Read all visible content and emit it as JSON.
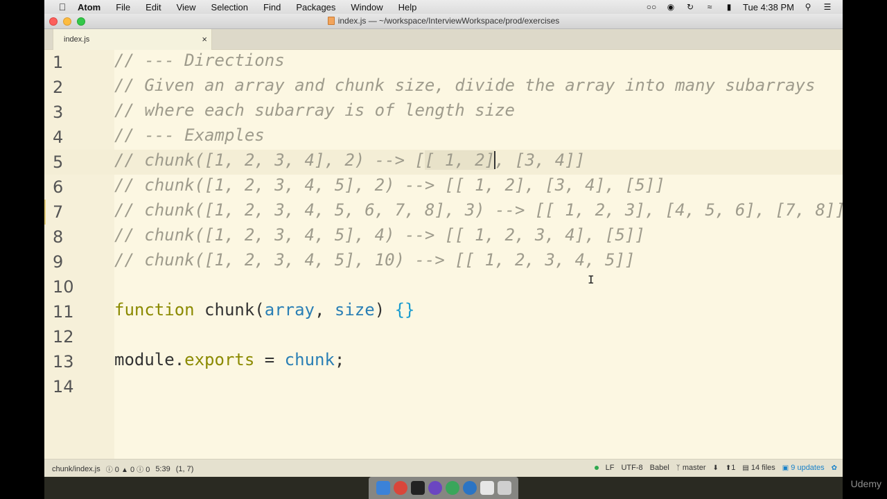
{
  "menubar": {
    "app_name": "Atom",
    "items": [
      "File",
      "Edit",
      "View",
      "Selection",
      "Find",
      "Packages",
      "Window",
      "Help"
    ],
    "clock": "Tue 4:38 PM"
  },
  "window": {
    "title": "index.js — ~/workspace/InterviewWorkspace/prod/exercises"
  },
  "tab": {
    "label": "index.js",
    "close": "×"
  },
  "editor": {
    "line_numbers": [
      "1",
      "2",
      "3",
      "4",
      "5",
      "6",
      "7",
      "8",
      "9",
      "10",
      "11",
      "12",
      "13",
      "14"
    ],
    "lines": {
      "l1": "// --- Directions",
      "l2": "// Given an array and chunk size, divide the array into many subarrays",
      "l3": "// where each subarray is of length size",
      "l4": "// --- Examples",
      "l5a": "// chunk([1, 2, 3, 4], 2) --> [",
      "l5sel": "[ 1, 2]",
      "l5b": ", [3, 4]]",
      "l6": "// chunk([1, 2, 3, 4, 5], 2) --> [[ 1, 2], [3, 4], [5]]",
      "l7": "// chunk([1, 2, 3, 4, 5, 6, 7, 8], 3) --> [[ 1, 2, 3], [4, 5, 6], [7, 8]]",
      "l8": "// chunk([1, 2, 3, 4, 5], 4) --> [[ 1, 2, 3, 4], [5]]",
      "l9": "// chunk([1, 2, 3, 4, 5], 10) --> [[ 1, 2, 3, 4, 5]]",
      "l11_kw": "function",
      "l11_name": " chunk(",
      "l11_p1": "array",
      "l11_sep": ", ",
      "l11_p2": "size",
      "l11_close": ") ",
      "l11_braces": "{}",
      "l13_obj": "module.",
      "l13_prop": "exports",
      "l13_eq": " = ",
      "l13_val": "chunk",
      "l13_end": ";"
    }
  },
  "statusbar": {
    "file_path": "chunk/index.js",
    "errors": "0",
    "warnings": "0",
    "infos": "0",
    "position": "5:39",
    "selection": "(1, 7)",
    "line_ending": "LF",
    "encoding": "UTF-8",
    "grammar": "Babel",
    "branch": "master",
    "ahead": "1",
    "files": "14 files",
    "updates": "9 updates"
  },
  "watermark": "Udemy",
  "colors": {
    "editor_bg": "#fcf7e2",
    "comment": "#9e9b8c",
    "keyword": "#8b8a00",
    "variable": "#2a7fb5",
    "updates": "#1a82c9"
  }
}
